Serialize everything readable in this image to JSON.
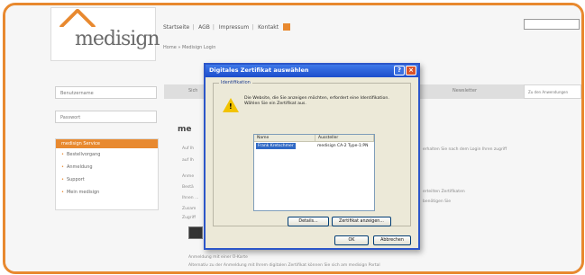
{
  "header": {
    "logo": "medisign",
    "topnav": [
      "Startseite",
      "AGB",
      "Impressum",
      "Kontakt"
    ],
    "breadcrumb": "Home » Medisign Login"
  },
  "sidebar": {
    "field1": "Benutzername",
    "field2": "Passwort",
    "menu_title": "medisign Service",
    "items": [
      "Bestellvorgang",
      "Anmeldung",
      "Support",
      "Mein medisign"
    ]
  },
  "tabs": {
    "left_label": "Sich",
    "right_label": "Newsletter",
    "extra": "Zu den Anwendungen"
  },
  "main": {
    "heading": "me",
    "lines": [
      "Auf Ih",
      "auf Ih",
      "Anme",
      "Bestä",
      "Ihnen ...",
      "Zusam",
      "Zugriff",
      "erhalten Sie nach dem Login Ihren zugriff",
      "erteilten Zertifikaten",
      "benötigen Sie"
    ],
    "bottom_line1": "Anmeldung mit einer Ü-Karte",
    "bottom_line2": "Alternativ zu der Anmeldung mit Ihrem digitalen Zertifikat können Sie sich am medisign Portal"
  },
  "dialog": {
    "title": "Digitales Zertifikat auswählen",
    "group_label": "Identifikation",
    "prompt": "Die Website, die Sie anzeigen möchten, erfordert eine Identifikation. Wählen Sie ein Zertifikat aus.",
    "columns": [
      "Name",
      "Aussteller"
    ],
    "certificates": [
      {
        "name": "Frank Kretschmer",
        "issuer": "medisign CA-2 Type-1:PN"
      }
    ],
    "buttons": {
      "details": "Details...",
      "view_cert": "Zertifikat anzeigen...",
      "ok": "OK",
      "cancel": "Abbrechen"
    }
  },
  "colors": {
    "accent": "#e8892f",
    "title_bar": "#1d4dcc",
    "selection": "#316ac5"
  }
}
